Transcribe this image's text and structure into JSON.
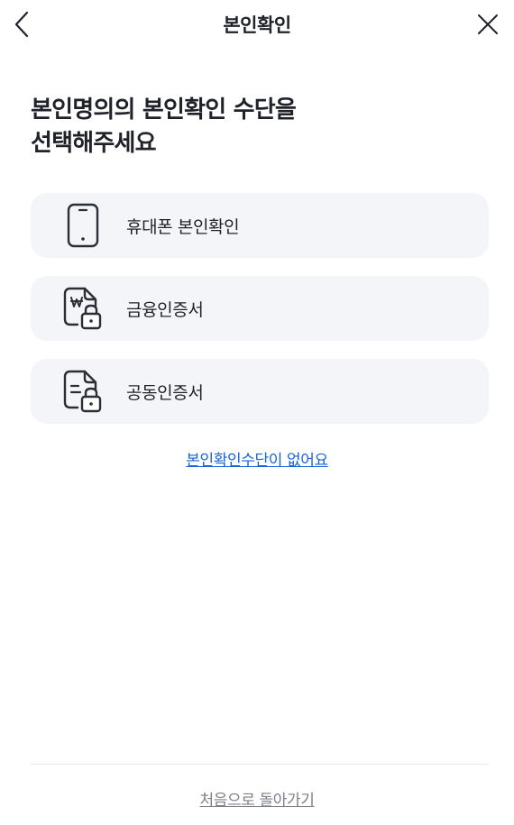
{
  "header": {
    "title": "본인확인",
    "back_icon": "chevron-left-icon",
    "close_icon": "close-icon"
  },
  "headline": {
    "line1": "본인명의의 본인확인 수단을",
    "line2": "선택해주세요"
  },
  "options": [
    {
      "label": "휴대폰 본인확인",
      "icon": "smartphone-icon"
    },
    {
      "label": "금융인증서",
      "icon": "won-document-lock-icon"
    },
    {
      "label": "공동인증서",
      "icon": "document-lock-icon"
    }
  ],
  "links": {
    "no_method": "본인확인수단이 없어요",
    "back_home": "처음으로 돌아가기"
  },
  "colors": {
    "text": "#1f2329",
    "option_bg": "#f3f5f8",
    "link_blue": "#1a63d6",
    "link_gray": "#7b8089",
    "divider": "#e6e8eb"
  }
}
